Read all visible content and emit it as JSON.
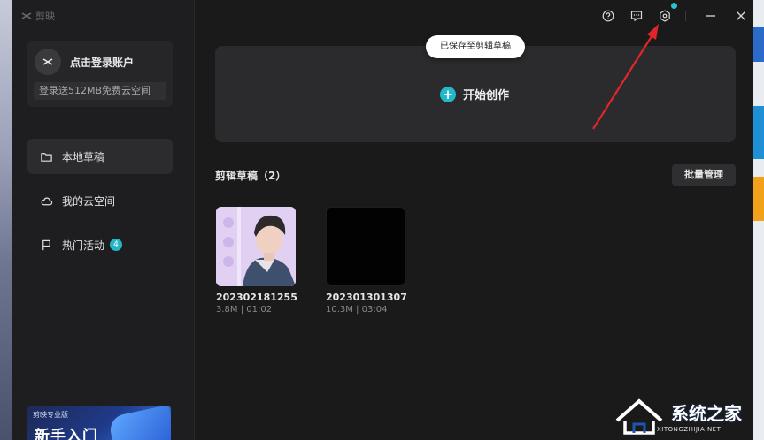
{
  "app": {
    "logo_text": "剪映"
  },
  "account": {
    "login_label": "点击登录账户",
    "promo": "登录送512MB免费云空间"
  },
  "sidebar": {
    "items": [
      {
        "label": "本地草稿",
        "icon": "folder-icon",
        "active": true
      },
      {
        "label": "我的云空间",
        "icon": "cloud-icon",
        "active": false
      },
      {
        "label": "热门活动",
        "icon": "flag-icon",
        "active": false,
        "badge": "4"
      }
    ]
  },
  "banner": {
    "brand": "剪映专业版",
    "title": "新手入门"
  },
  "titlebar": {
    "icons": [
      "help-icon",
      "feedback-icon",
      "settings-icon",
      "minimize-icon",
      "close-icon"
    ]
  },
  "toast": {
    "text": "已保存至剪辑草稿"
  },
  "create": {
    "label": "开始创作"
  },
  "drafts": {
    "section_title": "剪辑草稿（2）",
    "batch_label": "批量管理",
    "items": [
      {
        "name": "202302181255",
        "meta": "3.8M | 01:02",
        "thumb": "photo"
      },
      {
        "name": "202301301307",
        "meta": "10.3M | 03:04",
        "thumb": "black"
      }
    ]
  },
  "watermark": {
    "text": "系统之家",
    "url": "XITONGZHIJIA.NET"
  },
  "colors": {
    "accent": "#22b8c8",
    "background": "#1a1a1a",
    "annotation": "#e0262a"
  }
}
